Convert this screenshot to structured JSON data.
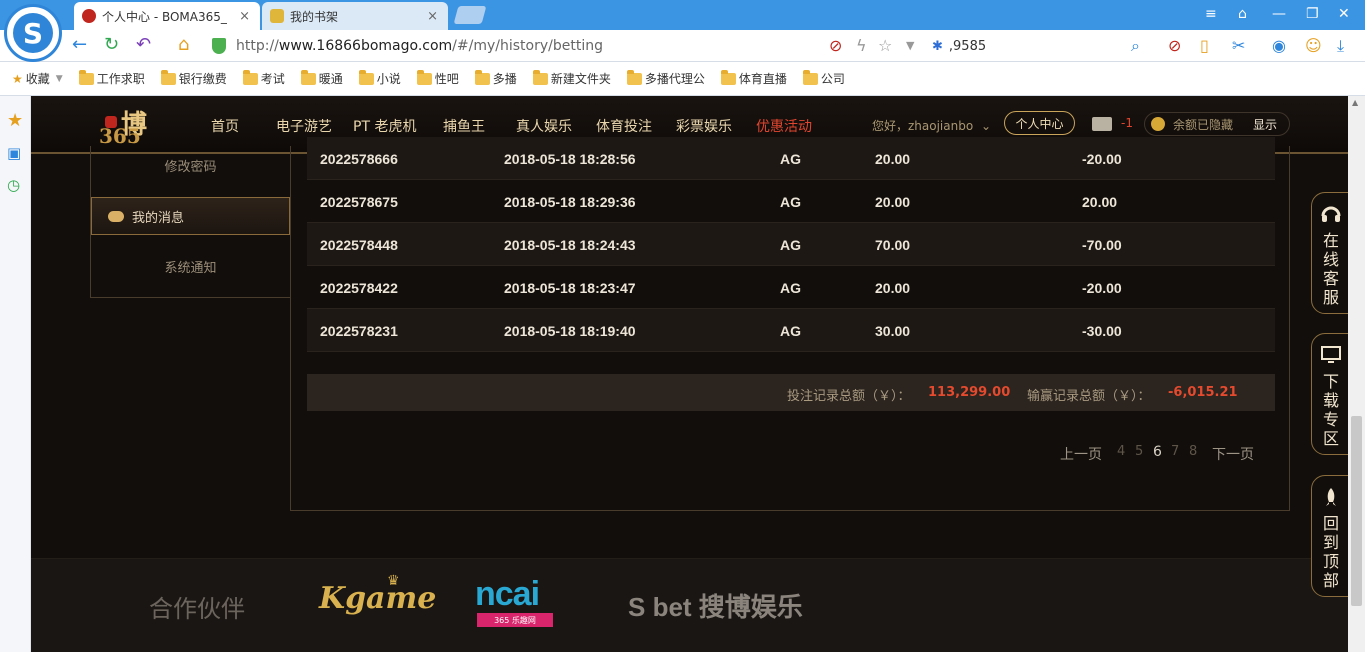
{
  "browser": {
    "tabs": [
      {
        "title": "个人中心 - BOMA365_",
        "close": "×"
      },
      {
        "title": "我的书架",
        "close": "×"
      }
    ],
    "address": {
      "prefix": "http://",
      "host": "www.16866bomago.com",
      "path": "/#/my/history/betting"
    },
    "search_value": ",9585",
    "bookmarks": [
      "收藏",
      "工作求职",
      "银行缴费",
      "考试",
      "暖通",
      "小说",
      "性吧",
      "多播",
      "新建文件夹",
      "多播代理公",
      "体育直播",
      "公司"
    ]
  },
  "site": {
    "logo": {
      "line1": "博",
      "line2": "365"
    },
    "nav": [
      "首页",
      "电子游艺",
      "PT 老虎机",
      "捕鱼王",
      "真人娱乐",
      "体育投注",
      "彩票娱乐",
      "优惠活动"
    ],
    "greeting": "您好，zhaojianbo",
    "user_center": "个人中心",
    "mail_count": "-1",
    "balance_text": "余额已隐藏",
    "balance_show": "显示",
    "side_menu": [
      "修改密码",
      "我的消息",
      "系统通知"
    ],
    "records": [
      {
        "id": "2022578666",
        "time": "2018-05-18 18:28:56",
        "platform": "AG",
        "bet": "20.00",
        "result": "-20.00"
      },
      {
        "id": "2022578675",
        "time": "2018-05-18 18:29:36",
        "platform": "AG",
        "bet": "20.00",
        "result": "20.00"
      },
      {
        "id": "2022578448",
        "time": "2018-05-18 18:24:43",
        "platform": "AG",
        "bet": "70.00",
        "result": "-70.00"
      },
      {
        "id": "2022578422",
        "time": "2018-05-18 18:23:47",
        "platform": "AG",
        "bet": "20.00",
        "result": "-20.00"
      },
      {
        "id": "2022578231",
        "time": "2018-05-18 18:19:40",
        "platform": "AG",
        "bet": "30.00",
        "result": "-30.00"
      }
    ],
    "summary": {
      "bet_label": "投注记录总额（￥）：",
      "bet_total": "113,299.00",
      "win_label": "输赢记录总额（￥）：",
      "win_total": "-6,015.21"
    },
    "pager": {
      "prev": "上一页",
      "pages": [
        "4",
        "5",
        "6",
        "7",
        "8"
      ],
      "current": "6",
      "next": "下一页"
    },
    "footer": {
      "partners": "合作伙伴",
      "kgame": "Kgame",
      "ncai": "ncai",
      "ncai_sub": "365 乐趣网",
      "sobet": "S bet 搜博娱乐"
    },
    "float_buttons": [
      "在线客服",
      "下载专区",
      "回到顶部"
    ]
  },
  "colors": {
    "accent_gold": "#c9a45b",
    "hot_red": "#e0462f",
    "total_red": "#e44a2e",
    "browser_blue": "#3c95e3"
  }
}
